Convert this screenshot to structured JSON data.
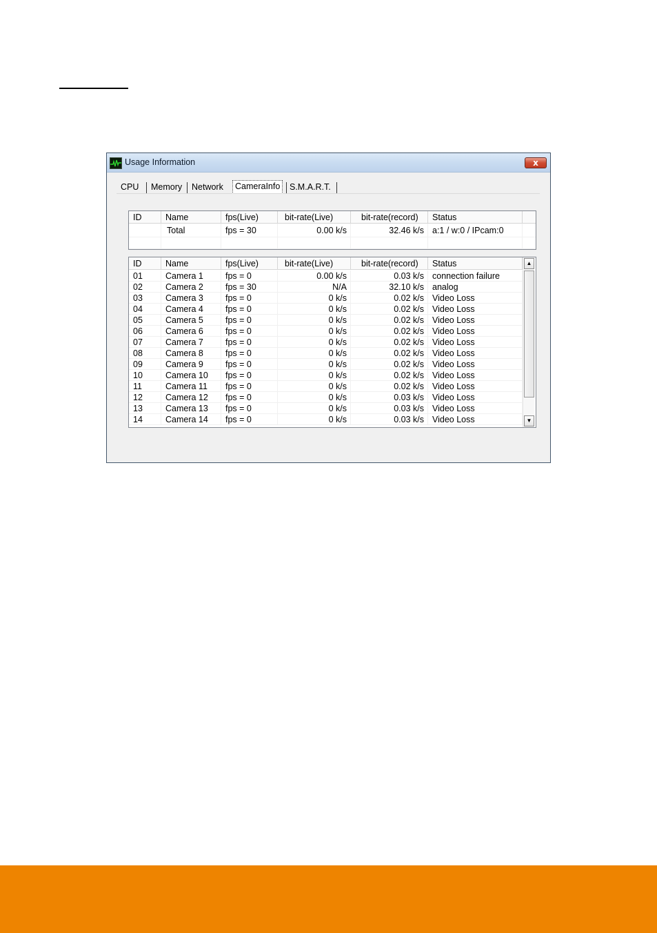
{
  "window": {
    "title": "Usage Information",
    "close_glyph": "x"
  },
  "tabs": [
    {
      "label": "CPU"
    },
    {
      "label": "Memory"
    },
    {
      "label": "Network"
    },
    {
      "label": "CameraInfo",
      "active": true
    },
    {
      "label": "S.M.A.R.T."
    }
  ],
  "summary_table": {
    "headers": [
      "ID",
      "Name",
      "fps(Live)",
      "bit-rate(Live)",
      "bit-rate(record)",
      "Status"
    ],
    "rows": [
      [
        "",
        "Total",
        "fps = 30",
        "0.00 k/s",
        "32.46 k/s",
        "a:1 / w:0 / IPcam:0"
      ]
    ]
  },
  "camera_table": {
    "headers": [
      "ID",
      "Name",
      "fps(Live)",
      "bit-rate(Live)",
      "bit-rate(record)",
      "Status"
    ],
    "rows": [
      [
        "01",
        "Camera 1",
        "fps = 0",
        "0.00 k/s",
        "0.03 k/s",
        "connection failure"
      ],
      [
        "02",
        "Camera 2",
        "fps = 30",
        "N/A",
        "32.10 k/s",
        "analog"
      ],
      [
        "03",
        "Camera 3",
        "fps = 0",
        "0 k/s",
        "0.02 k/s",
        "Video Loss"
      ],
      [
        "04",
        "Camera 4",
        "fps = 0",
        "0 k/s",
        "0.02 k/s",
        "Video Loss"
      ],
      [
        "05",
        "Camera 5",
        "fps = 0",
        "0 k/s",
        "0.02 k/s",
        "Video Loss"
      ],
      [
        "06",
        "Camera 6",
        "fps = 0",
        "0 k/s",
        "0.02 k/s",
        "Video Loss"
      ],
      [
        "07",
        "Camera 7",
        "fps = 0",
        "0 k/s",
        "0.02 k/s",
        "Video Loss"
      ],
      [
        "08",
        "Camera 8",
        "fps = 0",
        "0 k/s",
        "0.02 k/s",
        "Video Loss"
      ],
      [
        "09",
        "Camera 9",
        "fps = 0",
        "0 k/s",
        "0.02 k/s",
        "Video Loss"
      ],
      [
        "10",
        "Camera 10",
        "fps = 0",
        "0 k/s",
        "0.02 k/s",
        "Video Loss"
      ],
      [
        "11",
        "Camera 11",
        "fps = 0",
        "0 k/s",
        "0.02 k/s",
        "Video Loss"
      ],
      [
        "12",
        "Camera 12",
        "fps = 0",
        "0 k/s",
        "0.03 k/s",
        "Video Loss"
      ],
      [
        "13",
        "Camera 13",
        "fps = 0",
        "0 k/s",
        "0.03 k/s",
        "Video Loss"
      ],
      [
        "14",
        "Camera 14",
        "fps = 0",
        "0 k/s",
        "0.03 k/s",
        "Video Loss"
      ]
    ]
  },
  "scrollbar": {
    "up_glyph": "▲",
    "down_glyph": "▼"
  },
  "colors": {
    "footer": "#ee8400",
    "close_button": "#cf4d34"
  },
  "icons": {
    "app": "activity-monitor-icon",
    "close": "close-icon"
  }
}
